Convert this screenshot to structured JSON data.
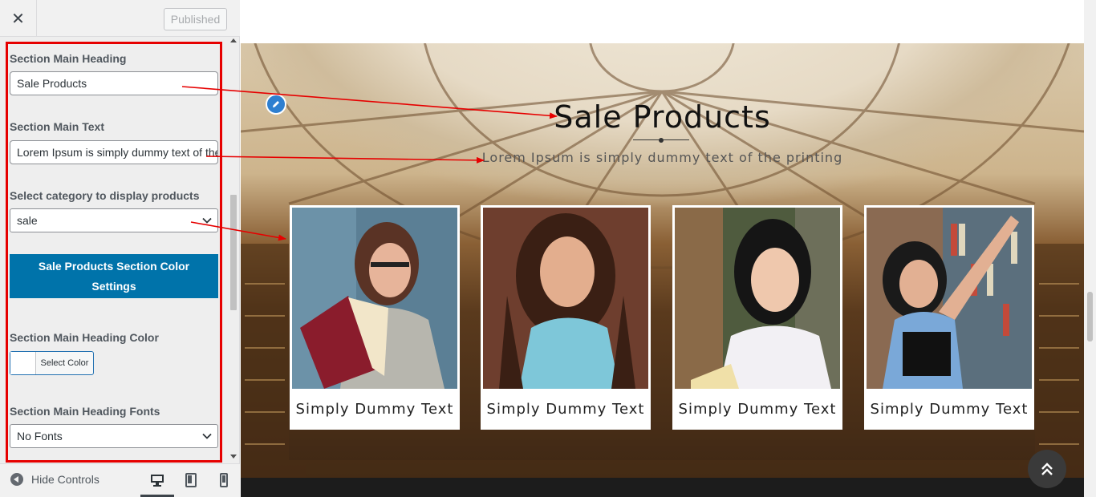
{
  "sidebar": {
    "close_icon": "close-icon",
    "publish_label": "Published",
    "fields": {
      "heading_label": "Section Main Heading",
      "heading_value": "Sale Products",
      "text_label": "Section Main Text",
      "text_value": "Lorem Ipsum is simply dummy text of the printing",
      "category_label": "Select category to display products",
      "category_value": "sale",
      "color_section_button": "Sale Products Section Color Settings",
      "heading_color_label": "Section Main Heading Color",
      "select_color_label": "Select Color",
      "heading_fonts_label": "Section Main Heading Fonts",
      "heading_fonts_value": "No Fonts"
    },
    "footer": {
      "hide_controls": "Hide Controls"
    }
  },
  "preview": {
    "heading": "Sale Products",
    "text": "Lorem Ipsum is simply dummy text of the printing",
    "cards": [
      {
        "title": "Simply Dummy Text"
      },
      {
        "title": "Simply Dummy Text"
      },
      {
        "title": "Simply Dummy Text"
      },
      {
        "title": "Simply Dummy Text"
      }
    ]
  },
  "colors": {
    "accent": "#0073aa",
    "highlight": "#e60000"
  }
}
